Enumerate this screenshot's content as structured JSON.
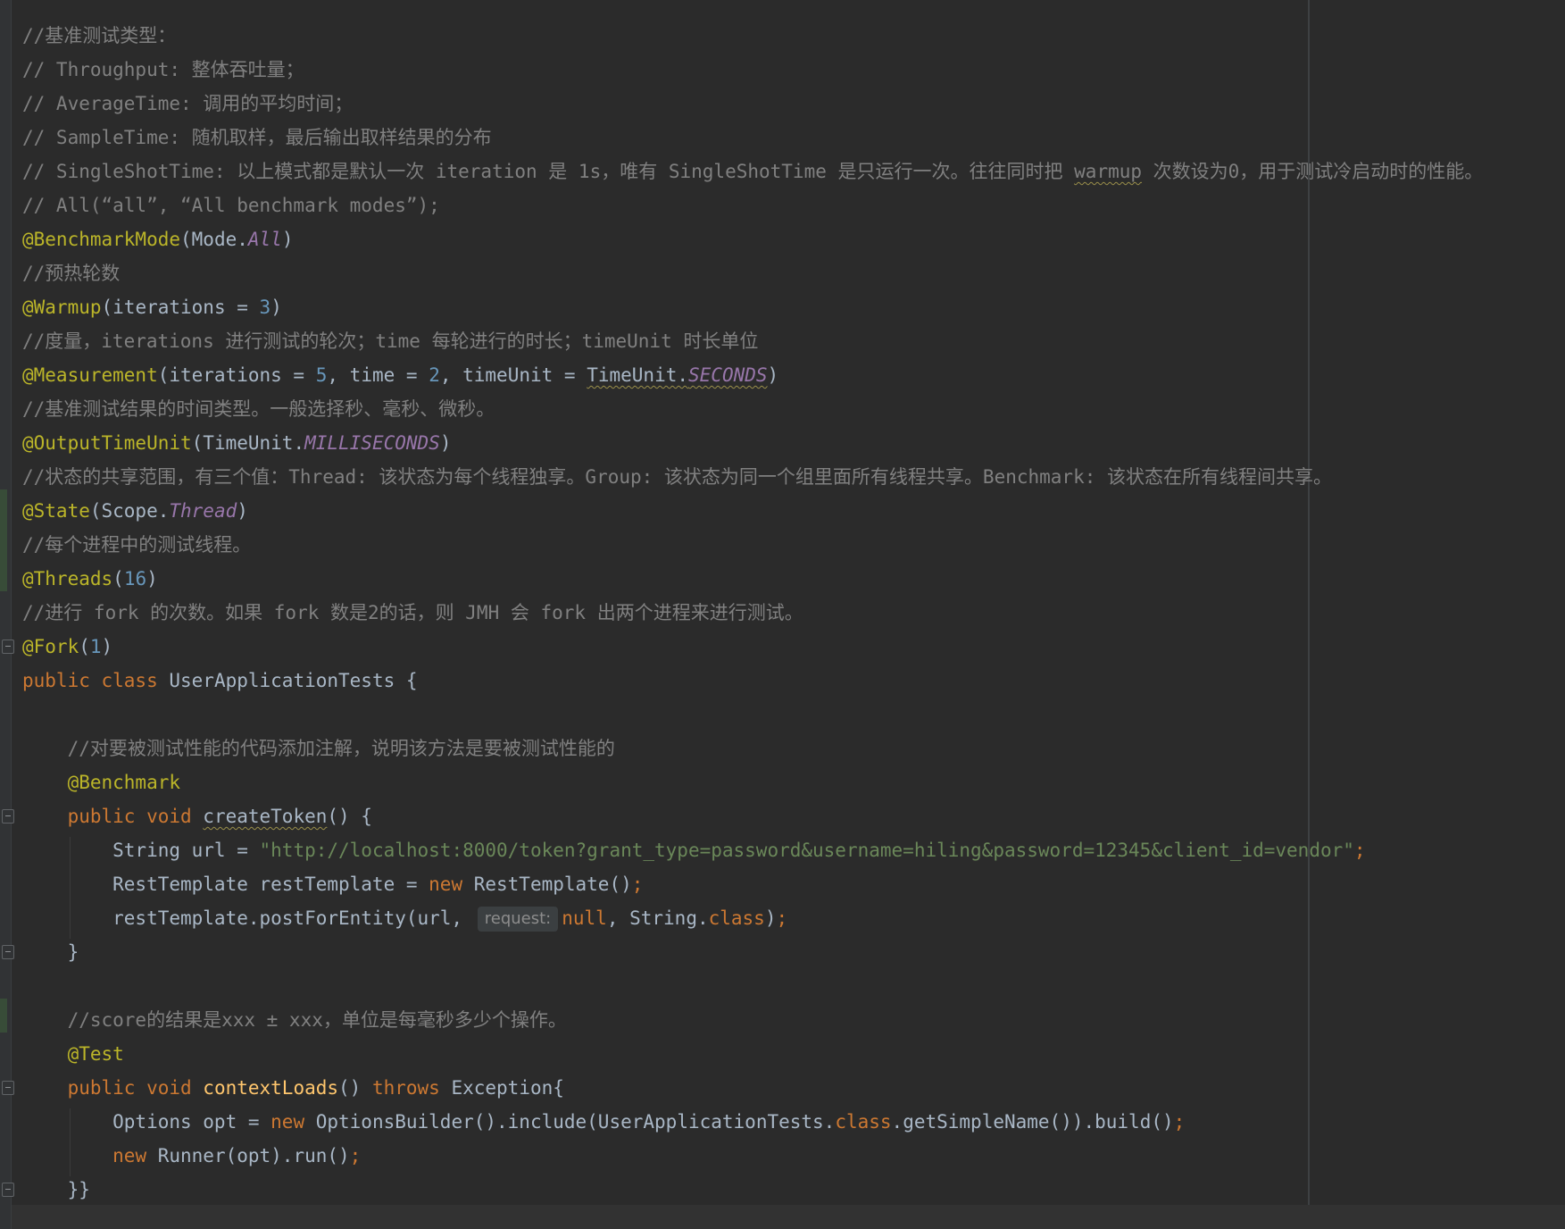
{
  "editor": {
    "lines": [
      {
        "text": "//基准测试类型："
      },
      {
        "text": "// Throughput: 整体吞吐量；"
      },
      {
        "text": "// AverageTime: 调用的平均时间；"
      },
      {
        "text": "// SampleTime: 随机取样，最后输出取样结果的分布"
      },
      {
        "a": "// SingleShotTime: 以上模式都是默认一次 iteration 是 1s，唯有 SingleShotTime 是只运行一次。往往同时把 ",
        "b": "warmup",
        "c": " 次数设为0，用于测试冷启动时的性能。"
      },
      {
        "text": "// All(“all”, “All benchmark modes”);"
      },
      {
        "ann": "@BenchmarkMode",
        "p1": "(Mode.",
        "const": "All",
        "p2": ")"
      },
      {
        "text": "//预热轮数"
      },
      {
        "ann": "@Warmup",
        "p1": "(iterations = ",
        "num": "3",
        "p2": ")"
      },
      {
        "text": "//度量，iterations 进行测试的轮次；time 每轮进行的时长；timeUnit 时长单位"
      },
      {
        "ann": "@Measurement",
        "p1": "(iterations = ",
        "n1": "5",
        "p2": ", time = ",
        "n2": "2",
        "p3": ", timeUnit = ",
        "p4": "TimeUnit.",
        "const": "SECONDS",
        "p5": ")"
      },
      {
        "text": "//基准测试结果的时间类型。一般选择秒、毫秒、微秒。"
      },
      {
        "ann": "@OutputTimeUnit",
        "p1": "(TimeUnit.",
        "const": "MILLISECONDS",
        "p2": ")"
      },
      {
        "text": "//状态的共享范围，有三个值：Thread: 该状态为每个线程独享。Group: 该状态为同一个组里面所有线程共享。Benchmark: 该状态在所有线程间共享。"
      },
      {
        "ann": "@State",
        "p1": "(Scope.",
        "const": "Thread",
        "p2": ")"
      },
      {
        "text": "//每个进程中的测试线程。"
      },
      {
        "ann": "@Threads",
        "p1": "(",
        "num": "16",
        "p2": ")"
      },
      {
        "text": "//进行 fork 的次数。如果 fork 数是2的话，则 JMH 会 fork 出两个进程来进行测试。"
      },
      {
        "ann": "@Fork",
        "p1": "(",
        "num": "1",
        "p2": ")"
      },
      {
        "kw": "public class ",
        "p1": "UserApplicationTests {"
      },
      {
        "text": "    //对要被测试性能的代码添加注解，说明该方法是要被测试性能的"
      },
      {
        "ann": "    @Benchmark"
      },
      {
        "kw": "    public void ",
        "name": "createToken",
        "p1": "() {"
      },
      {
        "p1": "        String url = ",
        "str": "\"http://localhost:8000/token?grant_type=password&username=hiling&password=12345&client_id=vendor\"",
        "semi": ";"
      },
      {
        "p1": "        RestTemplate restTemplate = ",
        "kw": "new ",
        "p2": "RestTemplate()",
        "semi": ";"
      },
      {
        "p1": "        restTemplate.postForEntity(url, ",
        "hint": "request:",
        "kw1": "null",
        "p2": ", String.",
        "kw2": "class",
        "p3": ")",
        "semi": ";"
      },
      {
        "text": "    }"
      },
      {
        "text": "    //score的结果是xxx ± xxx，单位是每毫秒多少个操作。"
      },
      {
        "ann": "    @Test"
      },
      {
        "kw": "    public void ",
        "name": "contextLoads",
        "p1": "() ",
        "kw2": "throws ",
        "p2": "Exception{"
      },
      {
        "p1": "        Options opt = ",
        "kw": "new ",
        "p2": "OptionsBuilder().include(UserApplicationTests.",
        "kw2": "class",
        "p3": ".getSimpleName()).build()",
        "semi": ";"
      },
      {
        "p1": "        ",
        "kw": "new ",
        "p2": "Runner(opt).run()",
        "semi": ";"
      },
      {
        "text": "    }}"
      }
    ]
  }
}
